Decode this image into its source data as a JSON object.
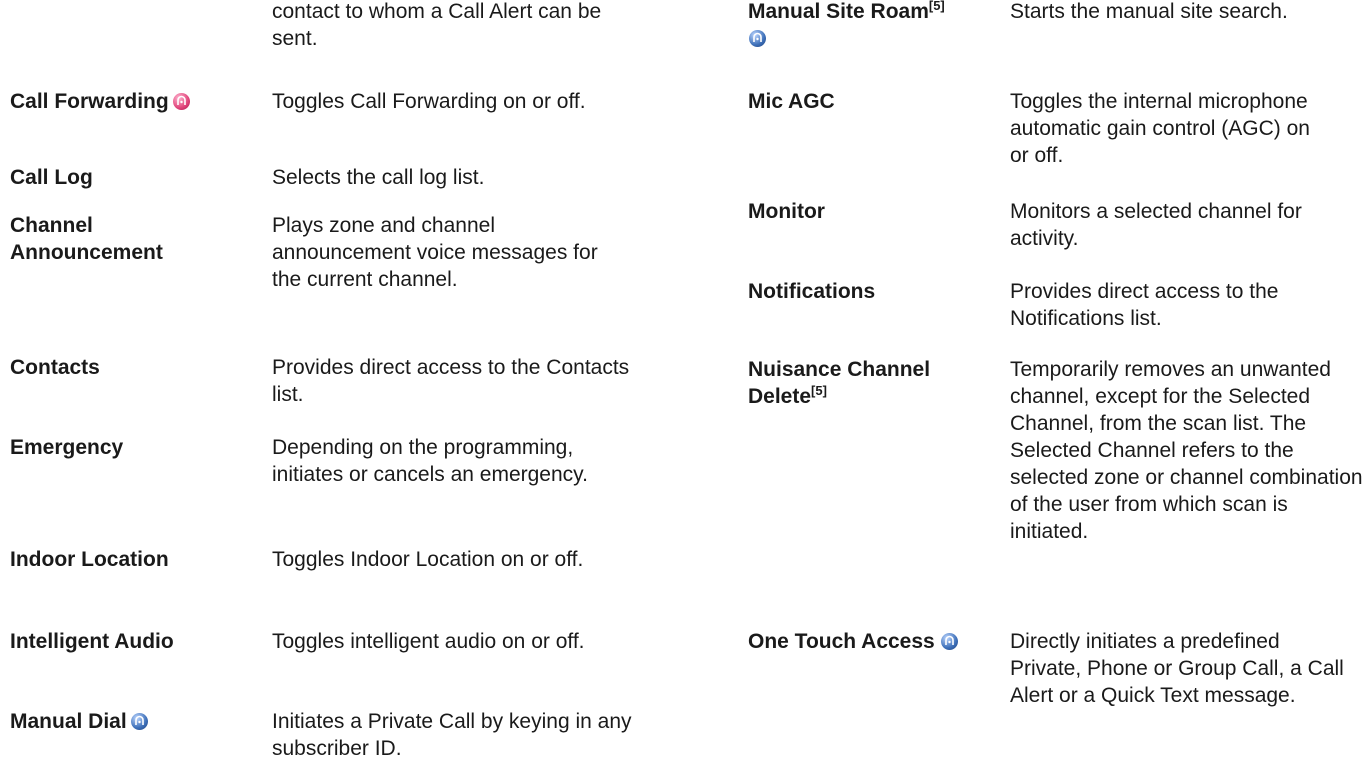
{
  "icons": {
    "pink": "pink-radio-icon",
    "blue": "blue-radio-icon"
  },
  "colors": {
    "pink_icon": "#e0447a",
    "blue_icon": "#3d6fb8"
  },
  "left": {
    "continuation": "contact to whom a Call Alert can be sent.",
    "rows": [
      {
        "term": "Call Forwarding",
        "desc": "Toggles Call Forwarding on or off."
      },
      {
        "term": "Call Log",
        "desc": "Selects the call log list."
      },
      {
        "term": "Channel Announcement",
        "desc": "Plays zone and channel announcement voice messages for the current channel."
      },
      {
        "term": "Contacts",
        "desc": "Provides direct access to the Contacts list."
      },
      {
        "term": "Emergency",
        "desc": "Depending on the programming, initiates or cancels an emergency."
      },
      {
        "term": "Indoor Location",
        "desc": "Toggles Indoor Location on or off."
      },
      {
        "term": "Intelligent Audio",
        "desc": "Toggles intelligent audio on or off."
      },
      {
        "term": "Manual Dial",
        "desc": "Initiates a Private Call by keying in any subscriber ID."
      }
    ]
  },
  "right": {
    "rows": [
      {
        "term": "Manual Site Roam",
        "sup": "[5]",
        "desc": "Starts the manual site search."
      },
      {
        "term": "Mic AGC",
        "desc": "Toggles the internal microphone automatic gain control (AGC) on or off."
      },
      {
        "term": "Monitor",
        "desc": "Monitors a selected channel for activity."
      },
      {
        "term": "Notifications",
        "desc": "Provides direct access to the Notifications list."
      },
      {
        "term": "Nuisance Channel Delete",
        "sup": "[5]",
        "desc": "Temporarily removes an unwanted channel, except for the Selected Channel, from the scan list. The Selected Channel refers to the selected zone or channel combination of the user from which scan is initiated."
      },
      {
        "term": "One Touch Access",
        "desc": "Directly initiates a predefined Private, Phone or Group Call, a Call Alert or a Quick Text message."
      }
    ]
  }
}
